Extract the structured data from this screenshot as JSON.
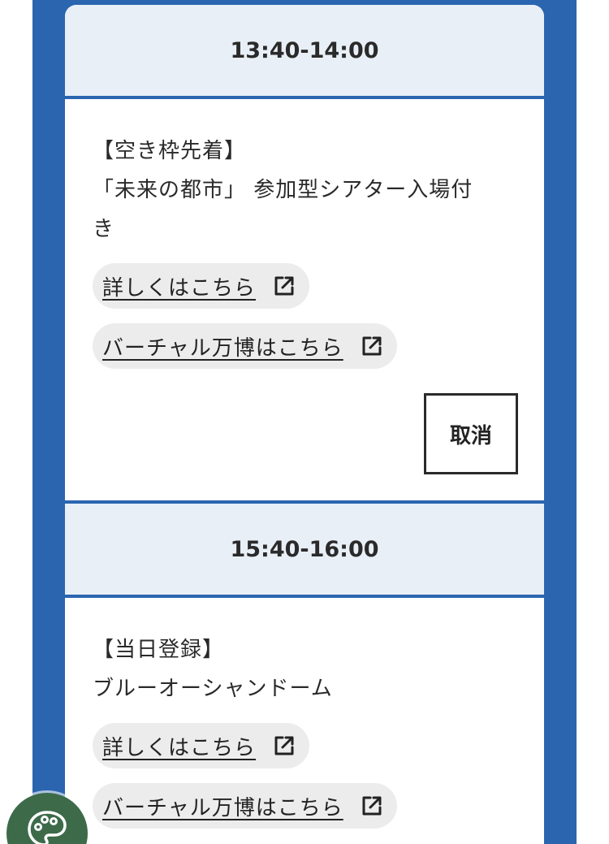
{
  "slots": [
    {
      "time": "13:40-14:00",
      "tag": "【空き枠先着】",
      "title_line1": "「未来の都市」 参加型シアター入場付",
      "title_line2": "き",
      "details_link": "詳しくはこちら",
      "virtual_link": "バーチャル万博はこちら",
      "cancel_label": "取消"
    },
    {
      "time": "15:40-16:00",
      "tag": "【当日登録】",
      "title_line1": "ブルーオーシャンドーム",
      "details_link": "詳しくはこちら",
      "virtual_link": "バーチャル万博はこちら"
    }
  ],
  "icons": {
    "link": "external-link-icon",
    "fab": "palette-icon"
  },
  "colors": {
    "frame_blue": "#2b65b0",
    "header_bg": "#e8eff7",
    "pill_bg": "#ececec",
    "fab_green": "#3d6b4a"
  }
}
